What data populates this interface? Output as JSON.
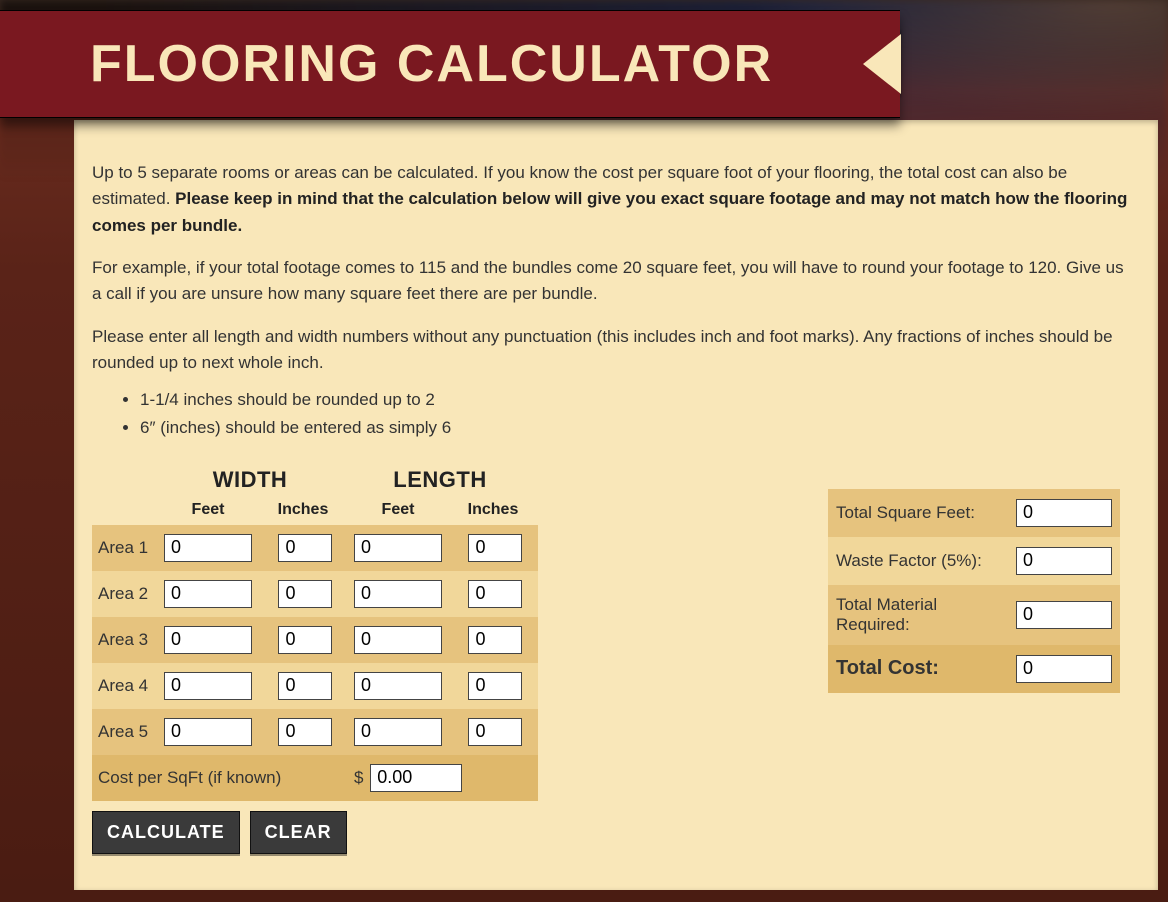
{
  "ribbon": {
    "title": "FLOORING CALCULATOR"
  },
  "intro": {
    "p1_lead": "Up to 5 separate rooms or areas can be calculated. If you know the cost per square foot of your flooring, the total cost can also be estimated. ",
    "p1_bold": "Please keep in mind that the calculation below will give you exact square footage and may not match how the flooring comes per bundle.",
    "p2": "For example, if your total footage comes to 115 and the bundles come 20 square feet, you will have to round your footage to 120. Give us a call if you are unsure how many square feet there are per bundle.",
    "p3": "Please enter all length and width numbers without any punctuation (this includes inch and foot marks). Any fractions of inches should be rounded up to next whole inch.",
    "bullets": [
      "1-1/4 inches should be rounded up to 2",
      "6″ (inches) should be entered as simply 6"
    ]
  },
  "table": {
    "width_header": "WIDTH",
    "length_header": "LENGTH",
    "feet_label": "Feet",
    "inches_label": "Inches",
    "rows": [
      {
        "label": "Area 1",
        "wf": "0",
        "wi": "0",
        "lf": "0",
        "li": "0"
      },
      {
        "label": "Area 2",
        "wf": "0",
        "wi": "0",
        "lf": "0",
        "li": "0"
      },
      {
        "label": "Area 3",
        "wf": "0",
        "wi": "0",
        "lf": "0",
        "li": "0"
      },
      {
        "label": "Area 4",
        "wf": "0",
        "wi": "0",
        "lf": "0",
        "li": "0"
      },
      {
        "label": "Area 5",
        "wf": "0",
        "wi": "0",
        "lf": "0",
        "li": "0"
      }
    ],
    "cost_label": "Cost per SqFt (if known)",
    "cost_value": "0.00"
  },
  "buttons": {
    "calculate": "CALCULATE",
    "clear": "CLEAR"
  },
  "results": {
    "sqft_label": "Total Square Feet:",
    "sqft_value": "0",
    "waste_label": "Waste Factor (5%):",
    "waste_value": "0",
    "material_label": "Total Material Required:",
    "material_value": "0",
    "cost_label": "Total Cost:",
    "cost_value": "0"
  }
}
